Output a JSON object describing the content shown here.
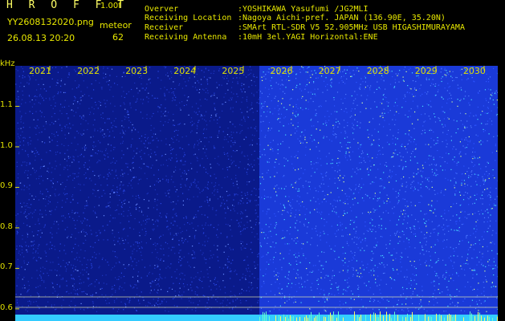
{
  "header": {
    "title": "H R O F F T",
    "version": "1.00f",
    "filename": "YY2608132020.png",
    "meteor_label": "meteor",
    "datetime": "26.08.13 20:20",
    "meteor_count": "62"
  },
  "info": [
    {
      "key": "Overver",
      "value": ":YOSHIKAWA Yasufumi /JG2MLI"
    },
    {
      "key": "Receiving Location",
      "value": ":Nagoya Aichi-pref. JAPAN (136.90E, 35.20N)"
    },
    {
      "key": "Receiver",
      "value": ":SMArt RTL-SDR V5 52.905MHz USB HIGASHIMURAYAMA"
    },
    {
      "key": "Receiving Antenna",
      "value": ":10mH 3el.YAGI Horizontal:ENE"
    }
  ],
  "chart_data": {
    "type": "heatmap",
    "ylabel": "kHz",
    "y_ticks": [
      "1.1",
      "1.0",
      "0.9",
      "0.8",
      "0.7",
      "0.6"
    ],
    "x_ticks": [
      "2021",
      "2022",
      "2023",
      "2024",
      "2025",
      "2026",
      "2027",
      "2028",
      "2029",
      "2030"
    ],
    "ylim": [
      0.57,
      1.2
    ],
    "split_after_tick": "2026",
    "colors": {
      "dark_bg": "#0a1a8a",
      "bright_bg": "#1a3ad8",
      "marker_line": "#ffffaa",
      "baseline": "#33ccff",
      "tick": "#e0e000"
    }
  }
}
